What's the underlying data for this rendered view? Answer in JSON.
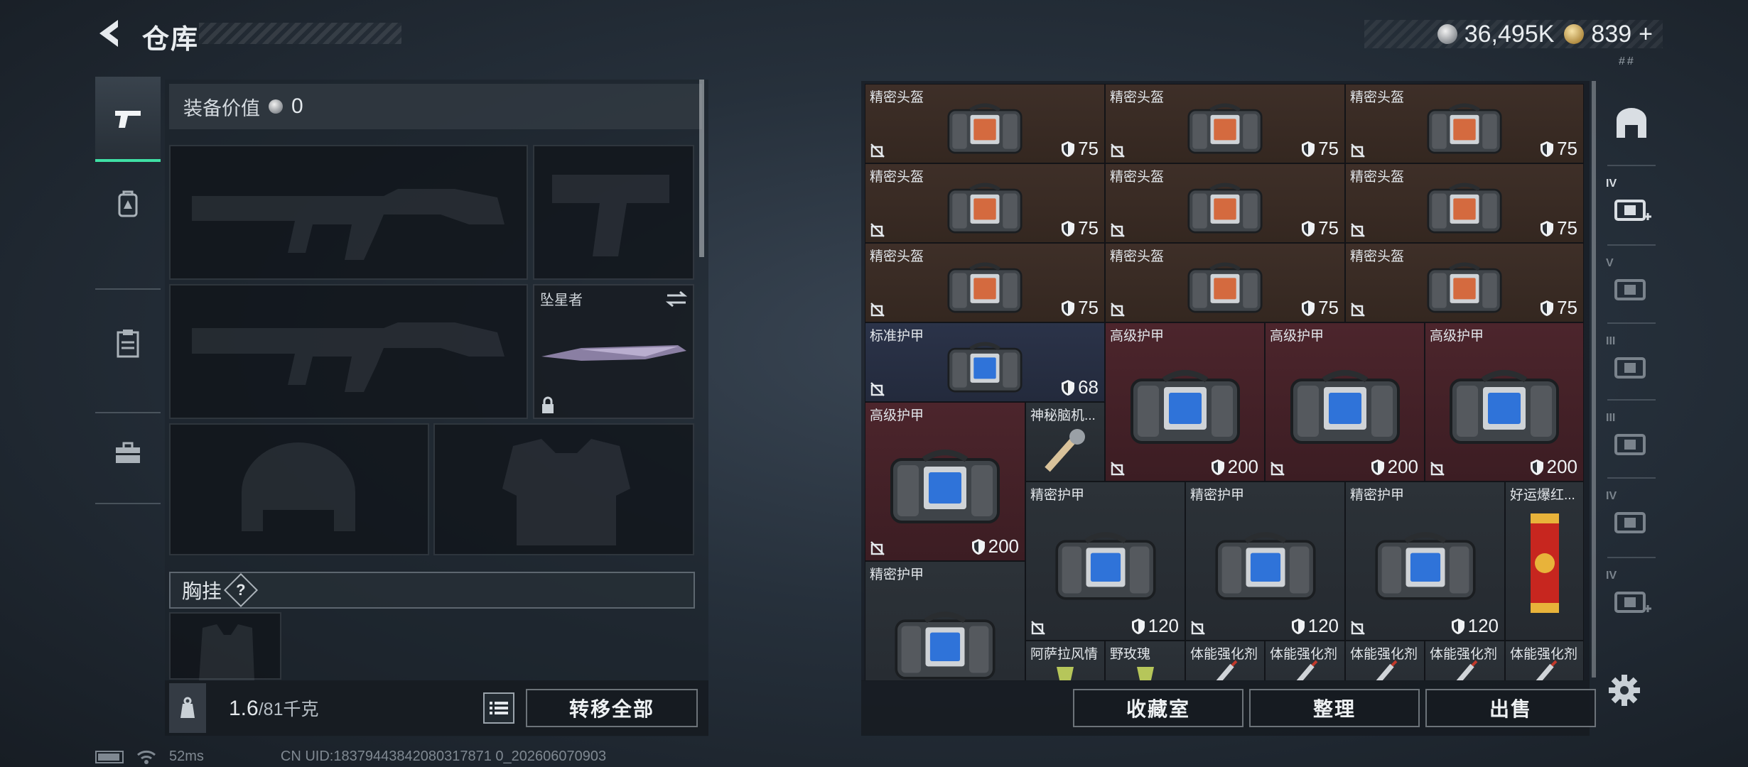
{
  "header": {
    "title": "仓库"
  },
  "currency": {
    "silver": "36,495K",
    "gold": "839",
    "gold_plus": "+",
    "sub_mark": "##"
  },
  "left_nav": {
    "items": [
      {
        "name": "weapons",
        "icon": "pistol-icon"
      },
      {
        "name": "backpack",
        "icon": "backpack-icon"
      },
      {
        "name": "vest",
        "icon": "clipboard-icon"
      },
      {
        "name": "toolbox",
        "icon": "toolbox-icon"
      }
    ]
  },
  "loadout": {
    "value_label": "装备价值",
    "value": "0",
    "melee_name": "坠星者",
    "chest_rig_label": "胸挂",
    "chest_rig_help": "?"
  },
  "bottom_left": {
    "weight_current": "1.6",
    "weight_max": "/81",
    "weight_unit": "千克",
    "transfer_all": "转移全部"
  },
  "inventory": {
    "items": [
      {
        "name": "精密头盔",
        "durability": "75"
      },
      {
        "name": "精密头盔",
        "durability": "75"
      },
      {
        "name": "精密头盔",
        "durability": "75"
      },
      {
        "name": "精密头盔",
        "durability": "75"
      },
      {
        "name": "精密头盔",
        "durability": "75"
      },
      {
        "name": "精密头盔",
        "durability": "75"
      },
      {
        "name": "精密头盔",
        "durability": "75"
      },
      {
        "name": "精密头盔",
        "durability": "75"
      },
      {
        "name": "精密头盔",
        "durability": "75"
      },
      {
        "name": "标准护甲",
        "durability": "68"
      },
      {
        "name": "高级护甲",
        "durability": "200"
      },
      {
        "name": "高级护甲",
        "durability": "200"
      },
      {
        "name": "高级护甲",
        "durability": "200"
      },
      {
        "name": "高级护甲",
        "durability": "200"
      },
      {
        "name": "神秘脑机...",
        "durability": ""
      },
      {
        "name": "精密护甲",
        "durability": "120"
      },
      {
        "name": "精密护甲",
        "durability": "120"
      },
      {
        "name": "精密护甲",
        "durability": "120"
      },
      {
        "name": "好运爆红...",
        "durability": ""
      },
      {
        "name": "精密护甲",
        "durability": ""
      },
      {
        "name": "阿萨拉风情",
        "durability": ""
      },
      {
        "name": "野玫瑰",
        "durability": ""
      },
      {
        "name": "体能强化剂",
        "durability": ""
      },
      {
        "name": "体能强化剂",
        "durability": ""
      },
      {
        "name": "体能强化剂",
        "durability": ""
      },
      {
        "name": "体能强化剂",
        "durability": ""
      },
      {
        "name": "体能强化剂",
        "durability": ""
      }
    ]
  },
  "bottom_right": {
    "collection": "收藏室",
    "organize": "整理",
    "sell": "出售"
  },
  "footer": {
    "ping": "52ms",
    "uid": "CN UID:18379443842080317871 0_202606070903"
  },
  "right_nav": {
    "items": [
      {
        "icon": "safe-box-icon"
      },
      {
        "icon": "stash-add-iv-icon",
        "label": "IV"
      },
      {
        "icon": "stash-v-icon",
        "label": "V"
      },
      {
        "icon": "stash-iii-icon",
        "label": "III"
      },
      {
        "icon": "stash-iii-tri-icon",
        "label": "III"
      },
      {
        "icon": "stash-iv-icon",
        "label": "IV"
      },
      {
        "icon": "stash-add-iv-2-icon",
        "label": "IV"
      }
    ]
  }
}
